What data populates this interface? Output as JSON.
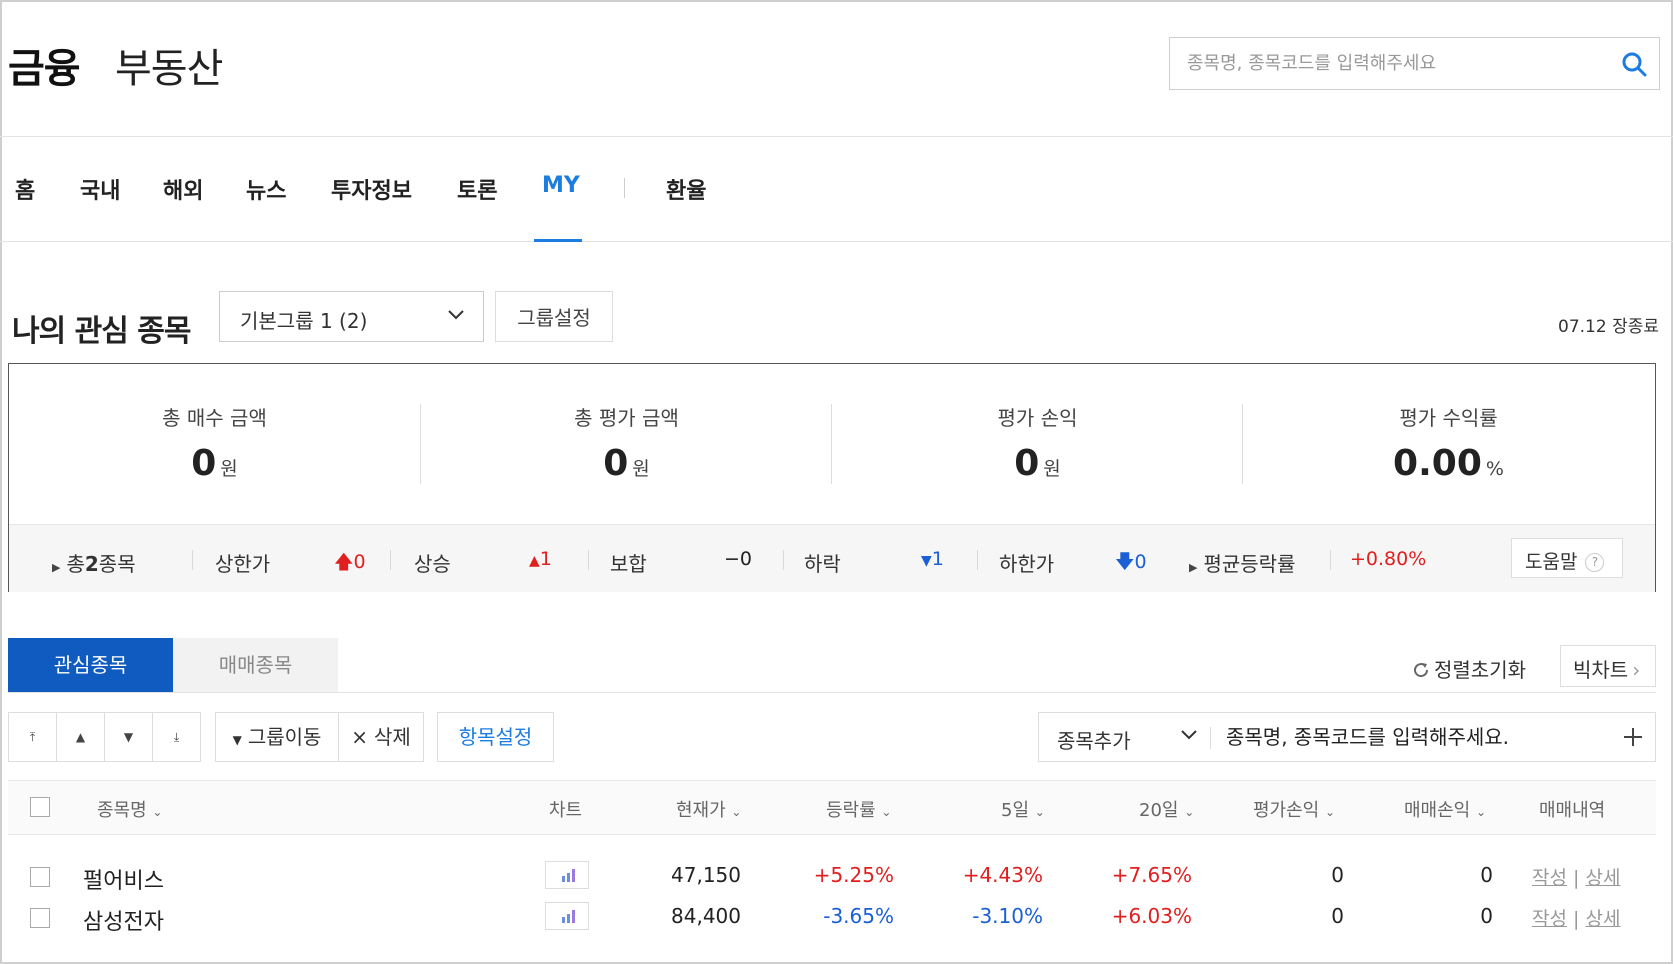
{
  "header": {
    "brand_finance": "금융",
    "brand_realestate": "부동산",
    "search_placeholder": "종목명, 종목코드를 입력해주세요"
  },
  "nav": {
    "items": [
      "홈",
      "국내",
      "해외",
      "뉴스",
      "투자정보",
      "토론",
      "MY",
      "환율"
    ],
    "active": "MY"
  },
  "watchlist": {
    "title": "나의 관심 종목",
    "group_select": "기본그룹 1 (2)",
    "group_setting": "그룹설정",
    "status": "07.12 장종료"
  },
  "summary": {
    "cols": [
      {
        "label": "총 매수 금액",
        "value": "0",
        "unit": "원"
      },
      {
        "label": "총 평가 금액",
        "value": "0",
        "unit": "원"
      },
      {
        "label": "평가 손익",
        "value": "0",
        "unit": "원"
      },
      {
        "label": "평가 수익률",
        "value": "0.00",
        "unit": "%"
      }
    ],
    "total_prefix": "총",
    "total_count": "2",
    "total_suffix": "종목",
    "upper_limit": {
      "label": "상한가",
      "value": "0"
    },
    "rise": {
      "label": "상승",
      "value": "1"
    },
    "flat": {
      "label": "보합",
      "value": "0"
    },
    "fall": {
      "label": "하락",
      "value": "1"
    },
    "lower_limit": {
      "label": "하한가",
      "value": "0"
    },
    "avg_change": {
      "label": "평균등락률",
      "value": "+0.80%"
    },
    "help": "도움말",
    "help_q": "?"
  },
  "tabs": {
    "watch": "관심종목",
    "trade": "매매종목",
    "sort_reset": "정렬초기화",
    "big_chart": "빅차트"
  },
  "toolbar": {
    "group_move": "그룹이동",
    "delete": "삭제",
    "item_setting": "항목설정",
    "add_select": "종목추가",
    "add_placeholder": "종목명, 종목코드를 입력해주세요."
  },
  "table": {
    "headers": {
      "name": "종목명",
      "chart": "차트",
      "price": "현재가",
      "change": "등락률",
      "d5": "5일",
      "d20": "20일",
      "eval_pl": "평가손익",
      "trade_pl": "매매손익",
      "history": "매매내역"
    },
    "rows": [
      {
        "name": "펄어비스",
        "price": "47,150",
        "change": "+5.25%",
        "d5": "+4.43%",
        "d20": "+7.65%",
        "eval_pl": "0",
        "trade_pl": "0",
        "write": "작성",
        "detail": "상세"
      },
      {
        "name": "삼성전자",
        "price": "84,400",
        "change": "-3.65%",
        "d5": "-3.10%",
        "d20": "+6.03%",
        "eval_pl": "0",
        "trade_pl": "0",
        "write": "작성",
        "detail": "상세"
      }
    ],
    "sep": "|"
  },
  "colors": {
    "accent": "#1c7ce0",
    "tab_active": "#0f5bbf",
    "up": "#e01f1f",
    "down": "#1a5fd6"
  }
}
